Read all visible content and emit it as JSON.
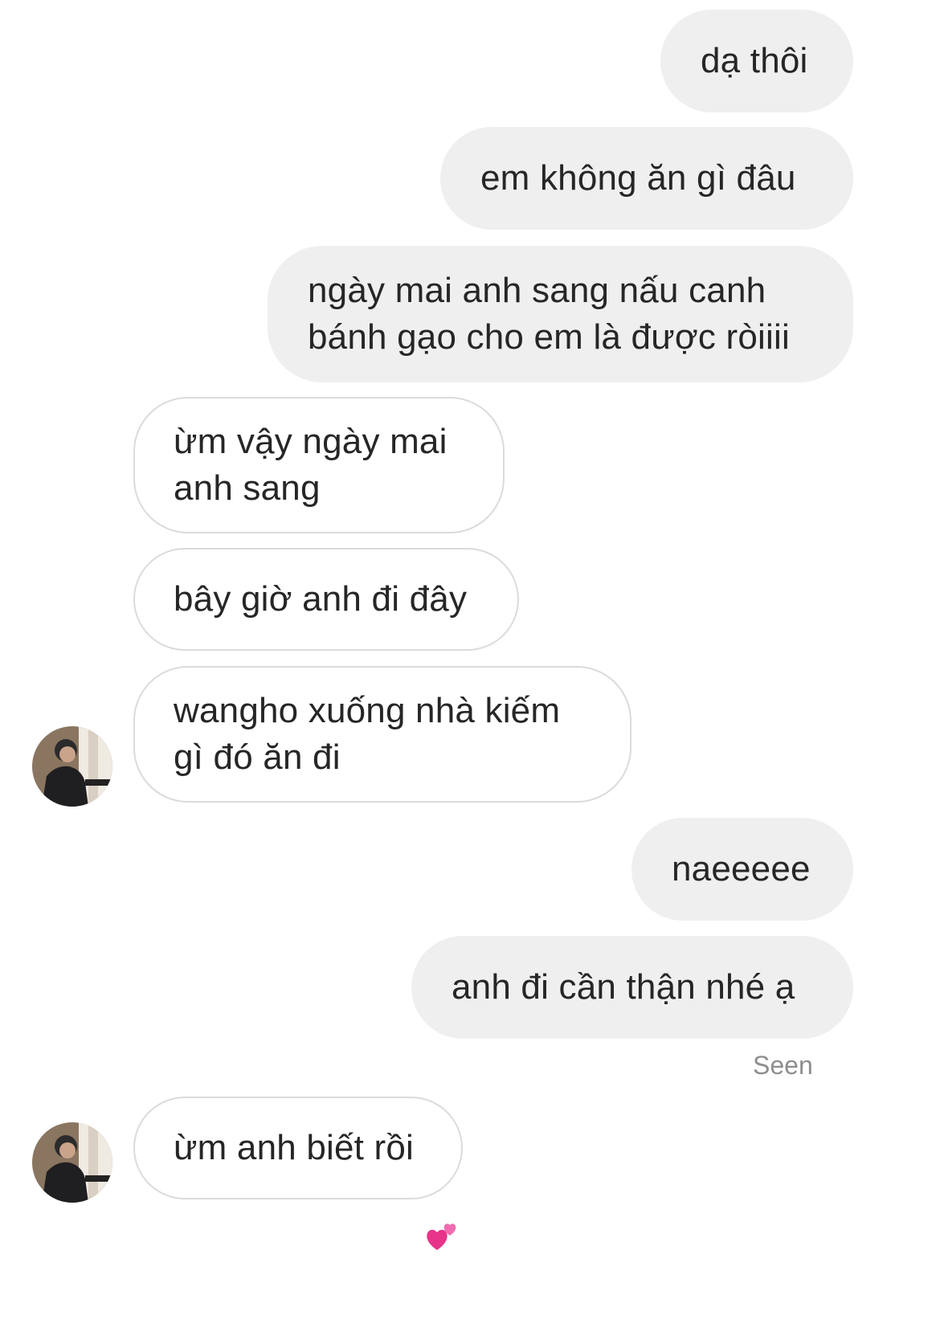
{
  "thread": {
    "messages": [
      {
        "from": "me",
        "text": "dạ thôi"
      },
      {
        "from": "me",
        "text": "em không ăn gì đâu"
      },
      {
        "from": "me",
        "text": "ngày mai anh sang nấu canh bánh gạo cho em là được ròiiii"
      },
      {
        "from": "them",
        "text": "ừm vậy ngày mai anh sang"
      },
      {
        "from": "them",
        "text": "bây giờ anh đi đây"
      },
      {
        "from": "them",
        "text": "wangho xuống nhà kiếm gì đó ăn đi"
      },
      {
        "from": "me",
        "text": "naeeeee"
      },
      {
        "from": "me",
        "text": "anh đi cần thận nhé ạ"
      },
      {
        "from": "them",
        "text": "ừm anh biết rồi"
      }
    ],
    "seen_label": "Seen",
    "reaction_icon": "two-hearts-icon",
    "colors": {
      "outgoing_bubble": "#efefef",
      "incoming_border": "#dbdbdb",
      "text": "#262626",
      "seen": "#8e8e8e",
      "heart": "#e8338a"
    }
  }
}
